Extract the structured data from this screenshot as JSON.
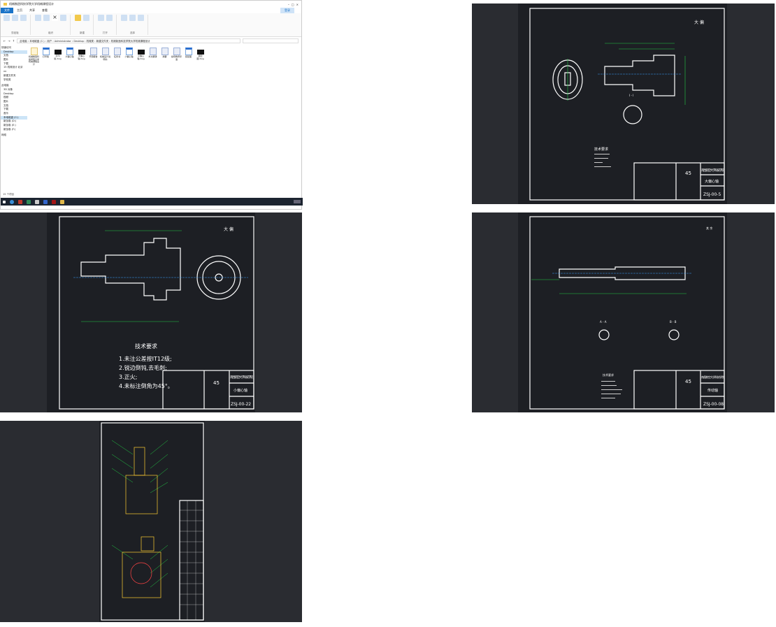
{
  "explorer": {
    "title": "机械制造科技学院大学机械课程设计",
    "tabs": [
      "文件",
      "主页",
      "共享",
      "查看"
    ],
    "ribbon_groups": [
      "剪贴板",
      "组织",
      "新建",
      "打开",
      "选择"
    ],
    "ribbon_buttons": [
      "固定到快速访问",
      "复制",
      "粘贴",
      "移动到",
      "复制到",
      "删除",
      "重命名",
      "新建文件夹",
      "属性",
      "全部选择",
      "全部取消",
      "反向选择"
    ],
    "address": [
      "此电脑",
      "本地磁盘 (C:)",
      "用户",
      "Administrator",
      "Desktop",
      "机械类",
      "新建文件夹",
      "机械制造科技学院大学机械课程设计"
    ],
    "sidebar": [
      "快速访问",
      "Desktop",
      "文档",
      "图片",
      "下载",
      "15 机械设计 北京",
      "xx",
      "新建文件夹",
      "学校类",
      "此电脑",
      "3D 对象",
      "Desktop",
      "视频",
      "图片",
      "文档",
      "下载",
      "音乐",
      "本地磁盘 (C:)",
      "新加卷 (D:)",
      "新加卷 (E:)",
      "新加卷 (F:)",
      "网络"
    ],
    "files": [
      {
        "name": "机械制造科技学院大学机械课程设计",
        "type": "folder"
      },
      {
        "name": "打印版",
        "type": "doc"
      },
      {
        "name": "打印版.dwg",
        "type": "dwg"
      },
      {
        "name": "大偏心轴",
        "type": "doc"
      },
      {
        "name": "大偏心轴.dwg",
        "type": "dwg"
      },
      {
        "name": "开题报告",
        "type": "txt"
      },
      {
        "name": "机械设计说明书",
        "type": "txt"
      },
      {
        "name": "任务书",
        "type": "txt"
      },
      {
        "name": "小偏心轴",
        "type": "doc"
      },
      {
        "name": "小偏心轴.dwg",
        "type": "dwg"
      },
      {
        "name": "外文翻译",
        "type": "txt"
      },
      {
        "name": "摘要",
        "type": "txt"
      },
      {
        "name": "指导教师评语",
        "type": "txt"
      },
      {
        "name": "装配图",
        "type": "doc"
      },
      {
        "name": "装配图.dwg",
        "type": "dwg"
      }
    ],
    "status": "15 个项目",
    "signin": "登录"
  },
  "drawings": {
    "big_shaft": {
      "view_label": "大 偏",
      "section": "I - I",
      "tech_title": "技术要求",
      "material": "45",
      "school": "南昌航空大学科技学院",
      "part": "大偏心轴",
      "code": "ZSJ-00-5"
    },
    "small_shaft": {
      "view_label": "大 偏",
      "tech_title": "技术要求",
      "tech_lines": [
        "1.未注公差按IT12级;",
        "2.锐边倒钝,去毛刺;",
        "3.正火;",
        "4.未标注倒角为45°。"
      ],
      "material": "45",
      "school": "南昌航空大学科技学院",
      "part": "小偏心轴",
      "code": "ZSJ-00-22"
    },
    "drive_shaft": {
      "view_label": "其 余",
      "section_a": "A - A",
      "section_b": "B - B",
      "tech_title": "技术要求",
      "material": "45",
      "school": "南昌航空大学科技学院",
      "part": "传动轴",
      "code": "ZSJ-00-08"
    }
  },
  "colors": {
    "cad_bg": "#1d1f24",
    "cad_line": "#ffffff",
    "cad_dim": "#22cc44",
    "cad_center": "#3aa0ff",
    "accent": "#1a73c8"
  }
}
